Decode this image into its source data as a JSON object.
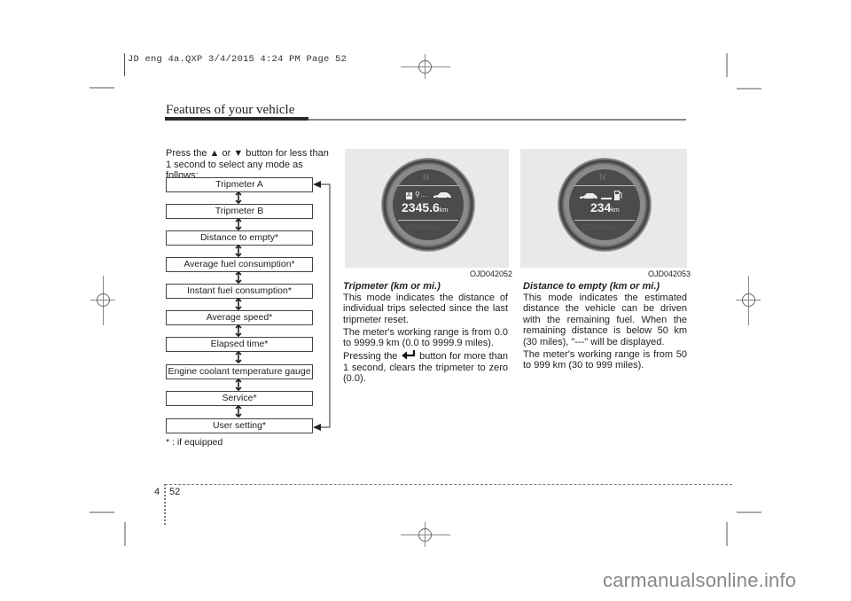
{
  "print_slug": "JD eng 4a.QXP  3/4/2015  4:24 PM  Page 52",
  "header": {
    "section_title": "Features of your vehicle"
  },
  "intro": {
    "text_before": "Press the ",
    "up_symbol": "▲",
    "middle": " or ",
    "down_symbol": "▼",
    "text_after": " button for less than 1 second to select any mode as follows:"
  },
  "modes": [
    {
      "label": "Tripmeter A"
    },
    {
      "label": "Tripmeter B"
    },
    {
      "label": "Distance to empty*"
    },
    {
      "label": "Average fuel consumption*"
    },
    {
      "label": "Instant fuel consumption*"
    },
    {
      "label": "Average speed*"
    },
    {
      "label": "Elapsed time*"
    },
    {
      "label": "Engine coolant temperature gauge"
    },
    {
      "label": "Service*"
    },
    {
      "label": "User setting*"
    }
  ],
  "footnote": "* : if equipped",
  "figures": [
    {
      "code": "OJD042052",
      "gear": "N",
      "mode_badge": "A",
      "display_value": "2345.6",
      "unit": "km",
      "odometer_ghost": "123456km"
    },
    {
      "code": "OJD042053",
      "gear": "N",
      "display_value": "234",
      "unit": "km",
      "odometer_ghost": "123456km"
    }
  ],
  "tripmeter_section": {
    "heading": "Tripmeter (km or mi.)",
    "para1": "This mode indicates the distance of individual trips selected since the last tripmeter reset.",
    "para2": "The meter's working range is from 0.0 to 9999.9 km (0.0 to 9999.9 miles).",
    "para3_before": "Pressing the ",
    "para3_after": " button for more than 1 second, clears the tripmeter to zero (0.0)."
  },
  "dte_section": {
    "heading": "Distance to empty (km or mi.)",
    "para1": "This mode indicates the estimated distance the vehicle can be driven with the remaining fuel. When the remaining distance is below 50 km (30 miles), \"---\" will be displayed.",
    "para2": "The meter's working range is from 50 to 999 km (30 to 999 miles)."
  },
  "footer": {
    "chapter": "4",
    "page": "52"
  },
  "watermark": "carmanualsonline.info"
}
